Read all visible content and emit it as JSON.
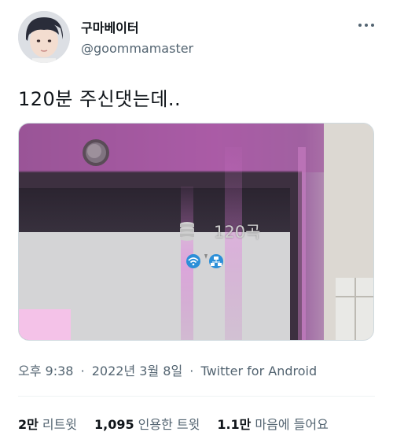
{
  "user": {
    "display_name": "구마베이터",
    "handle": "@goommamaster"
  },
  "icons": {
    "more": "more-horizontal-icon",
    "avatar": "avatar-photo",
    "storage": "storage-stack-icon",
    "wifi": "wifi-icon",
    "network": "network-icon"
  },
  "tweet": {
    "text": "120분 주신댓는데..",
    "media_overlay": "120곡"
  },
  "meta": {
    "time": "오후 9:38",
    "date": "2022년 3월 8일",
    "separator": "·",
    "source": "Twitter for Android"
  },
  "stats": {
    "retweets_count": "2만",
    "retweets_label": "리트윗",
    "quotes_count": "1,095",
    "quotes_label": "인용한 트윗",
    "likes_count": "1.1만",
    "likes_label": "마음에 들어요"
  },
  "colors": {
    "text_primary": "#0f1419",
    "text_secondary": "#536471",
    "media_purple": "#a0529a"
  }
}
